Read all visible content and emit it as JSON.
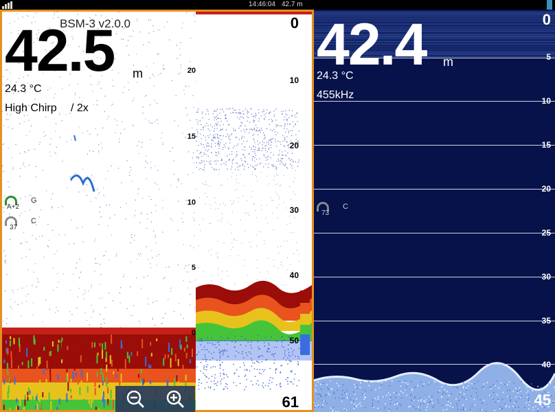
{
  "statusbar": {
    "time": "14:46:04",
    "depth": "42.7 m"
  },
  "left_panel": {
    "source": "BSM-3 v2.0.0",
    "depth": "42.5",
    "unit": "m",
    "temperature": "24.3 °C",
    "mode": "High Chirp",
    "zoom": "/ 2x",
    "gain_label": "A+2",
    "gain_suffix": "G",
    "contrast_value": "37",
    "contrast_suffix": "C",
    "zoom_scale": [
      "20",
      "15",
      "10",
      "5",
      "0"
    ],
    "depth_scale": [
      "0",
      "10",
      "20",
      "30",
      "40",
      "50"
    ],
    "range_bottom": "61"
  },
  "right_panel": {
    "depth": "42.4",
    "unit": "m",
    "temperature": "24.3 °C",
    "frequency": "455kHz",
    "contrast_value": "73",
    "contrast_suffix": "C",
    "depth_scale": [
      "0",
      "5",
      "10",
      "15",
      "20",
      "25",
      "30",
      "35",
      "40"
    ],
    "range_bottom": "45"
  },
  "icons": {
    "zoom_out": "zoom-out-icon",
    "zoom_in": "zoom-in-icon"
  },
  "colors": {
    "border": "#e6901f",
    "deep_water": "#07124a",
    "bottom_red": "#9a0d08"
  }
}
